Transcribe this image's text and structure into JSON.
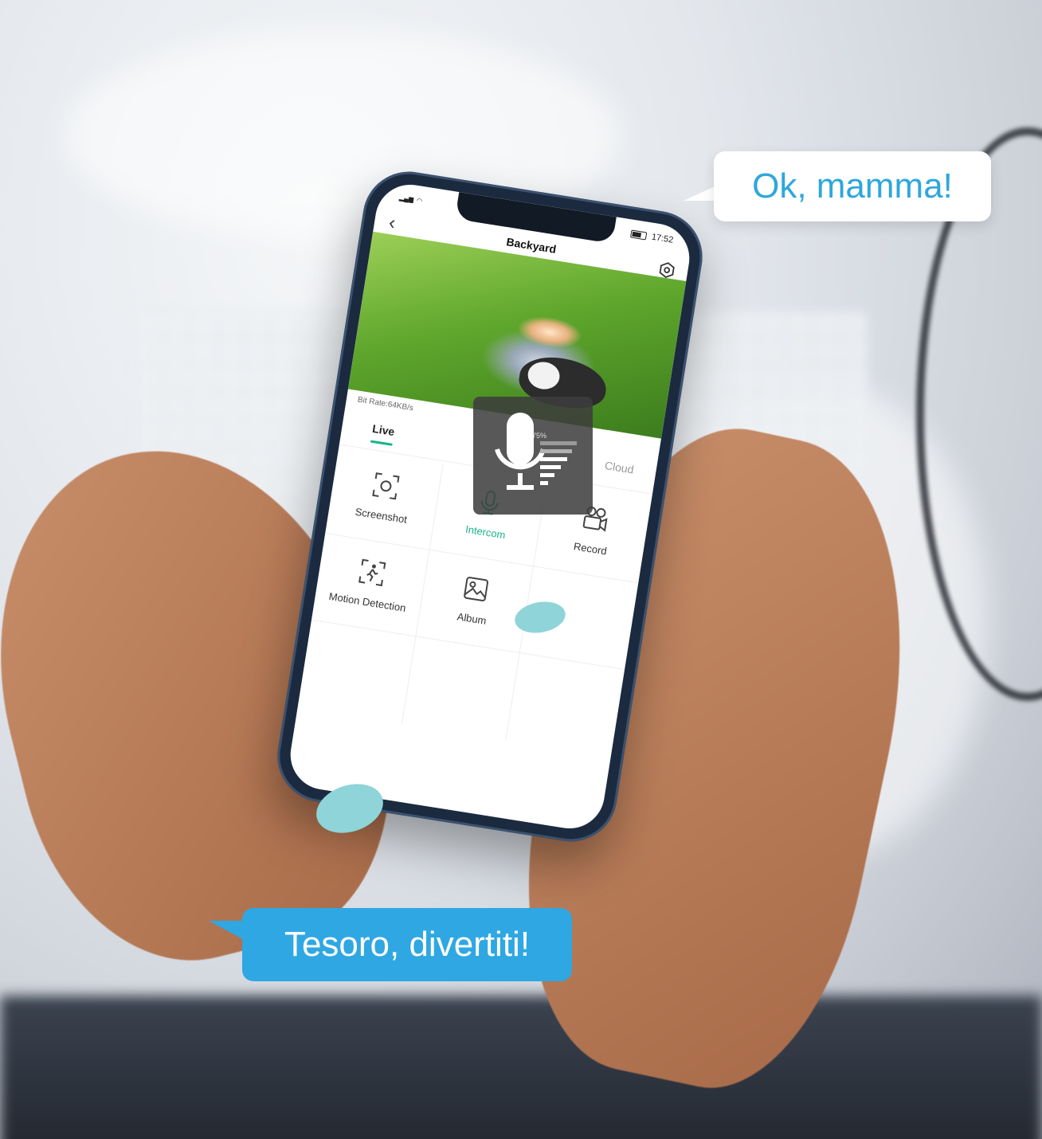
{
  "phone": {
    "status": {
      "time": "17:52"
    },
    "nav": {
      "title": "Backyard"
    },
    "stream": {
      "bit_rate": "Bit Rate:64KB/s"
    },
    "tabs": {
      "live": "Live",
      "cloud": "Cloud"
    },
    "actions": [
      {
        "label": "Screenshot",
        "icon": "screenshot-icon"
      },
      {
        "label": "Intercom",
        "icon": "microphone-icon"
      },
      {
        "label": "Record",
        "icon": "record-icon"
      },
      {
        "label": "Motion Detection",
        "icon": "motion-detection-icon"
      },
      {
        "label": "Album",
        "icon": "album-icon"
      }
    ],
    "intercom_overlay": {
      "volume": "75%"
    },
    "accent_color": "#18b58c"
  },
  "bubbles": {
    "reply": "Ok, mamma!",
    "message": "Tesoro, divertiti!"
  },
  "colors": {
    "bubble_blue": "#2fa7e2",
    "bubble_text_blue": "#2ea7dc"
  }
}
